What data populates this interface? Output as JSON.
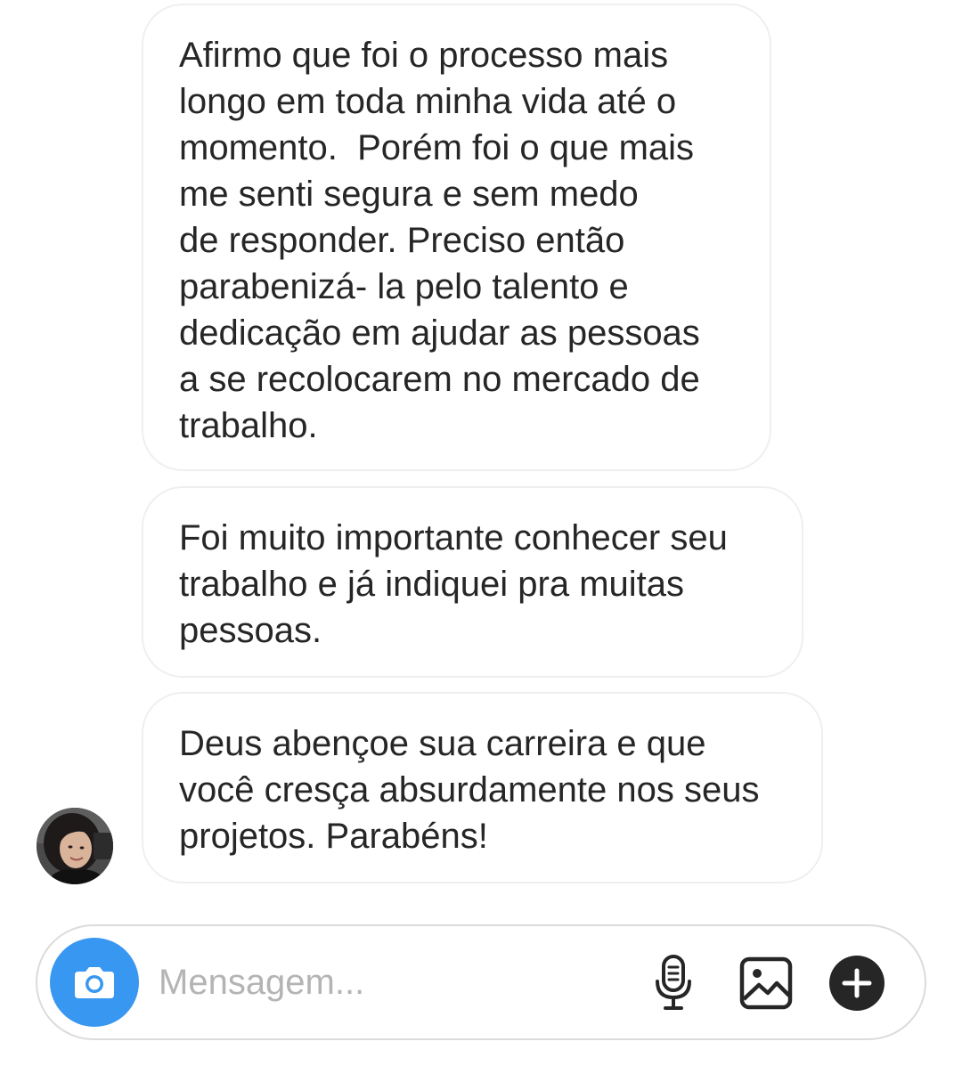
{
  "conversation": {
    "messages": [
      {
        "lines": [
          "Afirmo que foi o processo mais",
          "longo em toda minha vida até o",
          "momento.  Porém foi o que mais",
          "me senti segura e sem medo",
          "de responder. Preciso então",
          "parabenizá- la pelo talento e",
          "dedicação em ajudar as pessoas",
          "a se recolocarem no mercado de",
          "trabalho."
        ]
      },
      {
        "lines": [
          "Foi muito importante conhecer seu",
          "trabalho e já indiquei pra muitas",
          "pessoas."
        ]
      },
      {
        "lines": [
          "Deus abençoe sua carreira e que",
          "você cresça absurdamente nos seus",
          "projetos. Parabéns!"
        ]
      }
    ],
    "sender_avatar_icon": "user-avatar"
  },
  "composer": {
    "placeholder": "Mensagem...",
    "value": "",
    "camera_icon": "camera-icon",
    "mic_icon": "microphone-icon",
    "gallery_icon": "image-gallery-icon",
    "plus_icon": "plus-circle-icon",
    "accent_color": "#3897f0"
  }
}
